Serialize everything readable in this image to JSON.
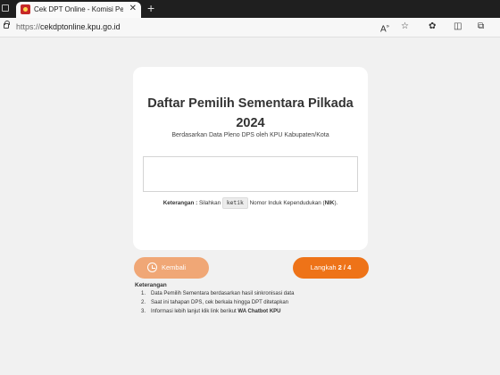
{
  "browser": {
    "tab_title": "Cek DPT Online - Komisi Pemilihan",
    "tab_close": "✕",
    "new_tab": "+",
    "url_protocol": "https://",
    "url_host": "cekdptonline.kpu.go.id",
    "toolbar_icons": [
      "read-aloud-icon",
      "favorite-star-icon",
      "extensions-icon",
      "split-screen-icon",
      "collections-icon"
    ]
  },
  "card": {
    "title": "Daftar Pemilih Sementara Pilkada 2024",
    "subtitle": "Berdasarkan Data Pleno DPS oleh KPU Kabupaten/Kota",
    "nik_input_value": "",
    "note_label": "Keterangan :",
    "note_before": "Silahkan",
    "note_code": "ketik",
    "note_after": "Nomor Induk Kependudukan (",
    "note_nik": "NIK",
    "note_end": ")."
  },
  "buttons": {
    "back_label": "Kembali",
    "next_label": "Langkah",
    "next_step": "2 / 4"
  },
  "keterangan": {
    "title": "Keterangan",
    "items": [
      {
        "num": "1.",
        "text": "Data Pemilih Sementara berdasarkan hasil sinkronisasi data"
      },
      {
        "num": "2.",
        "text": "Saat ini tahapan DPS, cek berkala hingga DPT ditetapkan"
      },
      {
        "num": "3.",
        "text": "Informasi lebih lanjut klik link berikut",
        "link": "WA Chatbot KPU"
      }
    ]
  },
  "colors": {
    "accent": "#ee7318",
    "accent_light": "#f0a776",
    "background": "#f1f1f1"
  }
}
